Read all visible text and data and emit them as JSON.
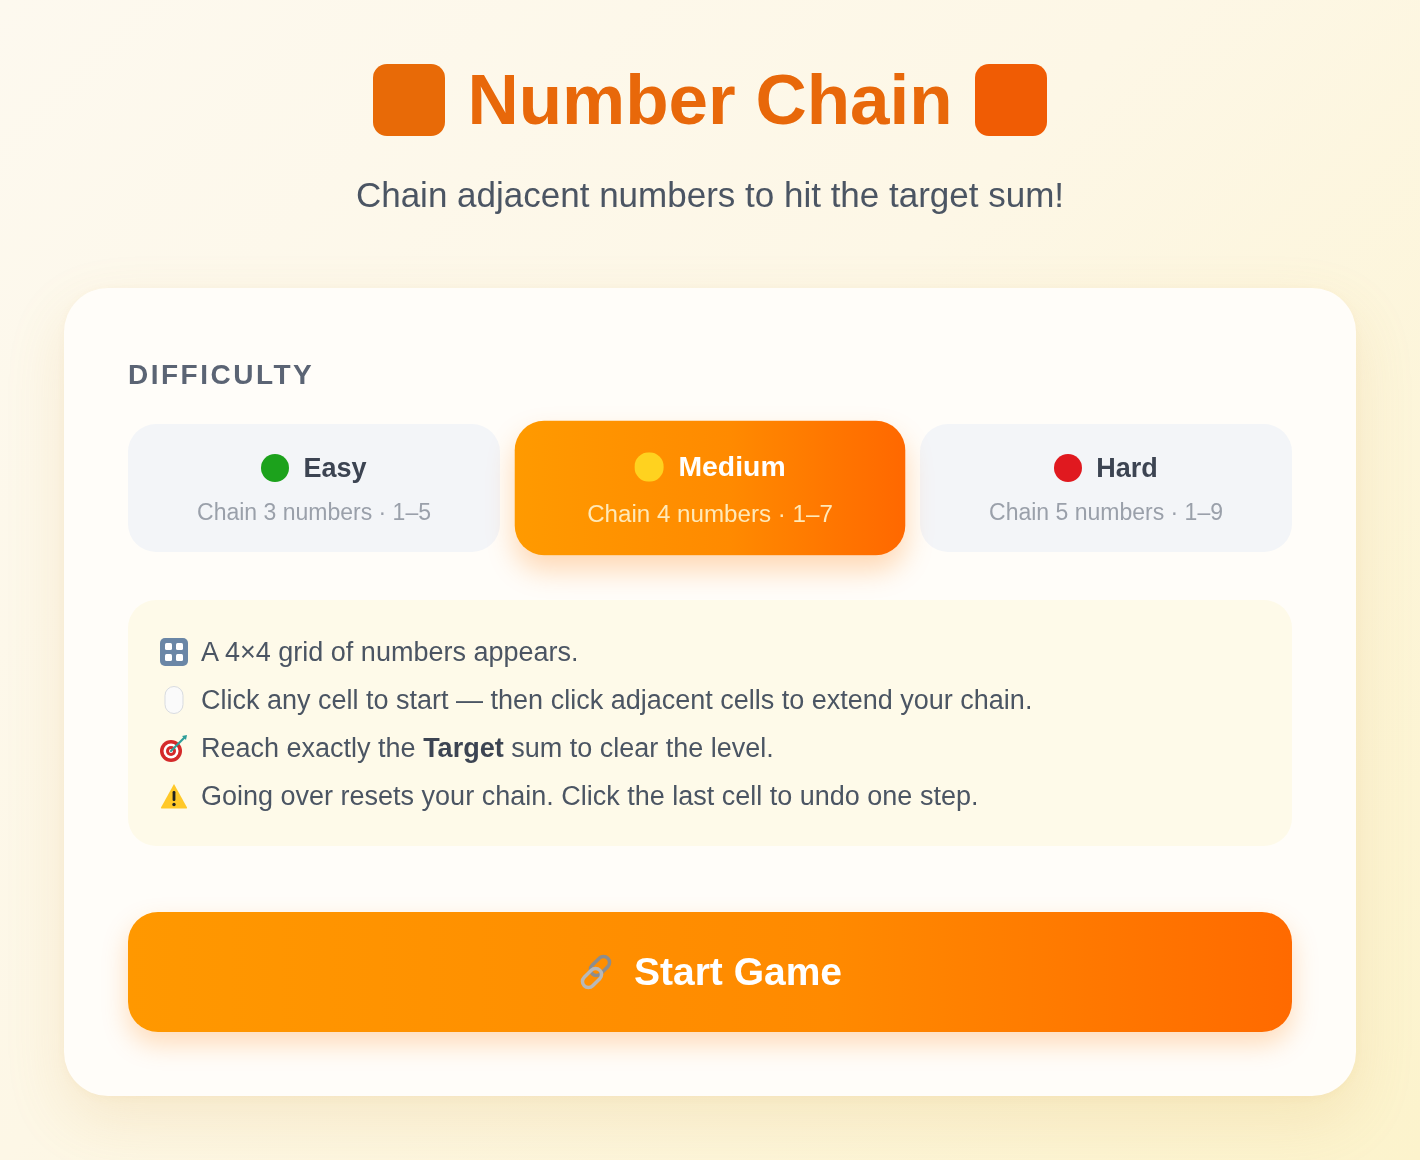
{
  "title": "Number Chain",
  "subtitle": "Chain adjacent numbers to hit the target sum!",
  "difficulty": {
    "heading": "DIFFICULTY",
    "options": [
      {
        "label": "Easy",
        "detail": "Chain 3 numbers · 1–5",
        "color": "#1ca21c",
        "selected": false
      },
      {
        "label": "Medium",
        "detail": "Chain 4 numbers · 1–7",
        "color": "#ffd21f",
        "selected": true
      },
      {
        "label": "Hard",
        "detail": "Chain 5 numbers · 1–9",
        "color": "#e0191f",
        "selected": false
      }
    ]
  },
  "instructions": [
    {
      "kind": "keypad",
      "text": "A 4×4 grid of numbers appears."
    },
    {
      "kind": "mouse",
      "text": "Click any cell to start — then click adjacent cells to extend your chain."
    },
    {
      "kind": "target",
      "text": "Reach exactly the **Target** sum to clear the level."
    },
    {
      "kind": "warning",
      "text": "Going over resets your chain. Click the last cell to undo one step."
    }
  ],
  "start_button": {
    "label": "Start Game"
  }
}
